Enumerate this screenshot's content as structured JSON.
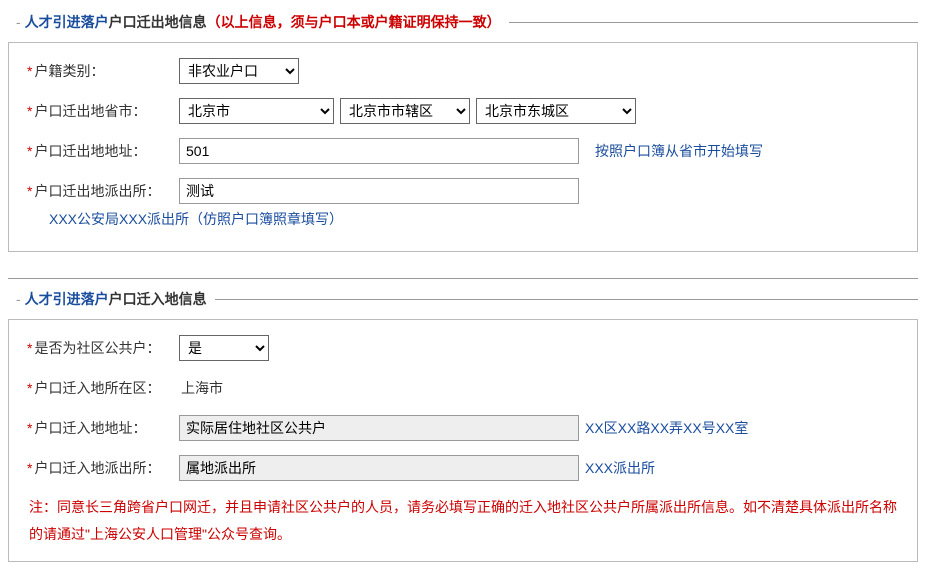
{
  "section1": {
    "title": "人才引进落户",
    "subtitle": " 户口迁出地信息",
    "note": "（以上信息，须与户口本或户籍证明保持一致）",
    "hukou_type": {
      "label": "户籍类别：",
      "value": "非农业户口"
    },
    "province": {
      "label": "户口迁出地省市：",
      "value_province": "北京市",
      "value_city": "北京市市辖区",
      "value_district": "北京市东城区"
    },
    "address": {
      "label": "户口迁出地地址：",
      "value": "501",
      "hint": "按照户口簿从省市开始填写"
    },
    "police_station": {
      "label": "户口迁出地派出所：",
      "value": "测试",
      "hint": "XXX公安局XXX派出所（仿照户口簿照章填写）"
    }
  },
  "section2": {
    "title": "人才引进落户",
    "subtitle": " 户口迁入地信息",
    "is_community": {
      "label": "是否为社区公共户：",
      "value": "是"
    },
    "in_area": {
      "label": "户口迁入地所在区：",
      "value": "上海市"
    },
    "in_address": {
      "label": "户口迁入地地址：",
      "value": "实际居住地社区公共户",
      "hint": "XX区XX路XX弄XX号XX室"
    },
    "in_police": {
      "label": "户口迁入地派出所：",
      "value": "属地派出所",
      "hint": "XXX派出所"
    },
    "warning": "注：同意长三角跨省户口网迁，并且申请社区公共户的人员，请务必填写正确的迁入地社区公共户所属派出所信息。如不清楚具体派出所名称的请通过\"上海公安人口管理\"公众号查询。"
  }
}
